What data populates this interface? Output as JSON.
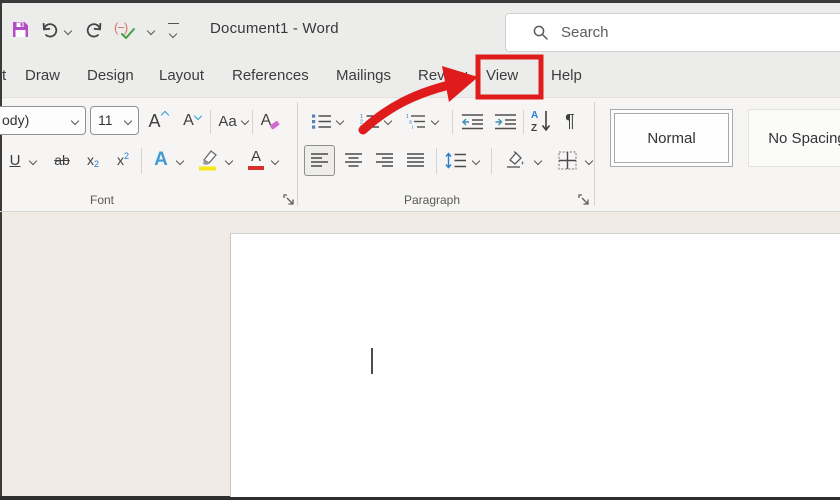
{
  "titlebar": {
    "title": "Document1 - Word"
  },
  "search": {
    "placeholder": "Search"
  },
  "tabs": [
    {
      "label": "t"
    },
    {
      "label": "Draw"
    },
    {
      "label": "Design"
    },
    {
      "label": "Layout"
    },
    {
      "label": "References"
    },
    {
      "label": "Mailings"
    },
    {
      "label": "Review"
    },
    {
      "label": "View"
    },
    {
      "label": "Help"
    }
  ],
  "ribbon": {
    "font": {
      "group_label": "Font",
      "font_name_value": "ody)",
      "font_size_value": "11",
      "grow_font": "A",
      "shrink_font": "A",
      "change_case": "Aa",
      "clear_formatting": "A",
      "underline": "U",
      "strikethrough": "ab",
      "subscript_base": "x",
      "subscript_small": "2",
      "superscript_base": "x",
      "superscript_small": "2",
      "text_effects": "A",
      "font_color": "A"
    },
    "paragraph": {
      "group_label": "Paragraph",
      "sort_a": "A",
      "sort_z": "Z",
      "pilcrow": "¶"
    },
    "styles": [
      {
        "label": "Normal"
      },
      {
        "label": "No Spacing"
      }
    ]
  },
  "colors": {
    "annotation_red": "#e01b1b",
    "save_icon_purple": "#b24fc4",
    "highlight_yellow": "#f7e71b",
    "font_color_red": "#d93025",
    "accent_blue": "#2b7cd3"
  }
}
